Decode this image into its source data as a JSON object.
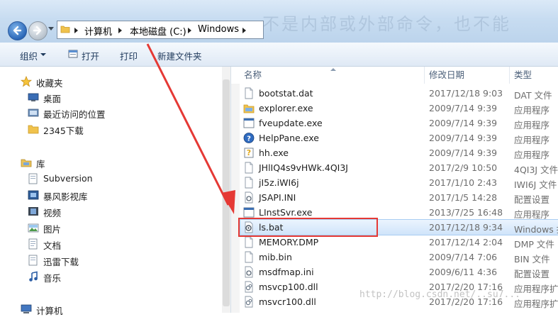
{
  "background_text": "不是内部或外部命令，也不能",
  "address": {
    "crumbs": [
      "计算机",
      "本地磁盘 (C:)",
      "Windows"
    ]
  },
  "toolbar": {
    "organize": "组织",
    "open": "打开",
    "print": "打印",
    "new_folder": "新建文件夹"
  },
  "nav": {
    "favorites": "收藏夹",
    "desktop": "桌面",
    "recent": "最近访问的位置",
    "downloads_2345": "2345下载",
    "libraries": "库",
    "subversion": "Subversion",
    "baofeng": "暴风影视库",
    "videos": "视频",
    "pictures": "图片",
    "documents": "文档",
    "thunder": "迅雷下载",
    "music": "音乐",
    "computer": "计算机"
  },
  "columns": {
    "name": "名称",
    "date": "修改日期",
    "type": "类型"
  },
  "files": [
    {
      "name": "bootstat.dat",
      "date": "2017/12/18 9:03",
      "type": "DAT 文件",
      "icon": "file-icon"
    },
    {
      "name": "explorer.exe",
      "date": "2009/7/14 9:39",
      "type": "应用程序",
      "icon": "explorer-icon"
    },
    {
      "name": "fveupdate.exe",
      "date": "2009/7/14 9:39",
      "type": "应用程序",
      "icon": "exe-icon"
    },
    {
      "name": "HelpPane.exe",
      "date": "2009/7/14 9:39",
      "type": "应用程序",
      "icon": "help-icon"
    },
    {
      "name": "hh.exe",
      "date": "2009/7/14 9:39",
      "type": "应用程序",
      "icon": "hh-icon"
    },
    {
      "name": "JHlIQ4s9vHWk.4QI3J",
      "date": "2017/2/9 10:50",
      "type": "4QI3J 文件",
      "icon": "file-icon"
    },
    {
      "name": "jI5z.iWI6j",
      "date": "2017/1/10 2:43",
      "type": "IWI6J 文件",
      "icon": "file-icon"
    },
    {
      "name": "JSAPI.INI",
      "date": "2017/1/5 14:28",
      "type": "配置设置",
      "icon": "ini-icon"
    },
    {
      "name": "LInstSvr.exe",
      "date": "2013/7/25 16:48",
      "type": "应用程序",
      "icon": "exe-icon"
    },
    {
      "name": "ls.bat",
      "date": "2017/12/18 9:34",
      "type": "Windows 批",
      "icon": "bat-icon"
    },
    {
      "name": "MEMORY.DMP",
      "date": "2017/12/14 2:04",
      "type": "DMP 文件",
      "icon": "file-icon"
    },
    {
      "name": "mib.bin",
      "date": "2009/7/14 7:06",
      "type": "BIN 文件",
      "icon": "file-icon"
    },
    {
      "name": "msdfmap.ini",
      "date": "2009/6/11 4:36",
      "type": "配置设置",
      "icon": "ini-icon"
    },
    {
      "name": "msvcp100.dll",
      "date": "2017/2/20 17:16",
      "type": "应用程序扩",
      "icon": "dll-icon"
    },
    {
      "name": "msvcr100.dll",
      "date": "2017/2/20 17:16",
      "type": "应用程序扩",
      "icon": "dll-icon"
    }
  ],
  "watermark": "http://blog.csdn.net/..su7..."
}
